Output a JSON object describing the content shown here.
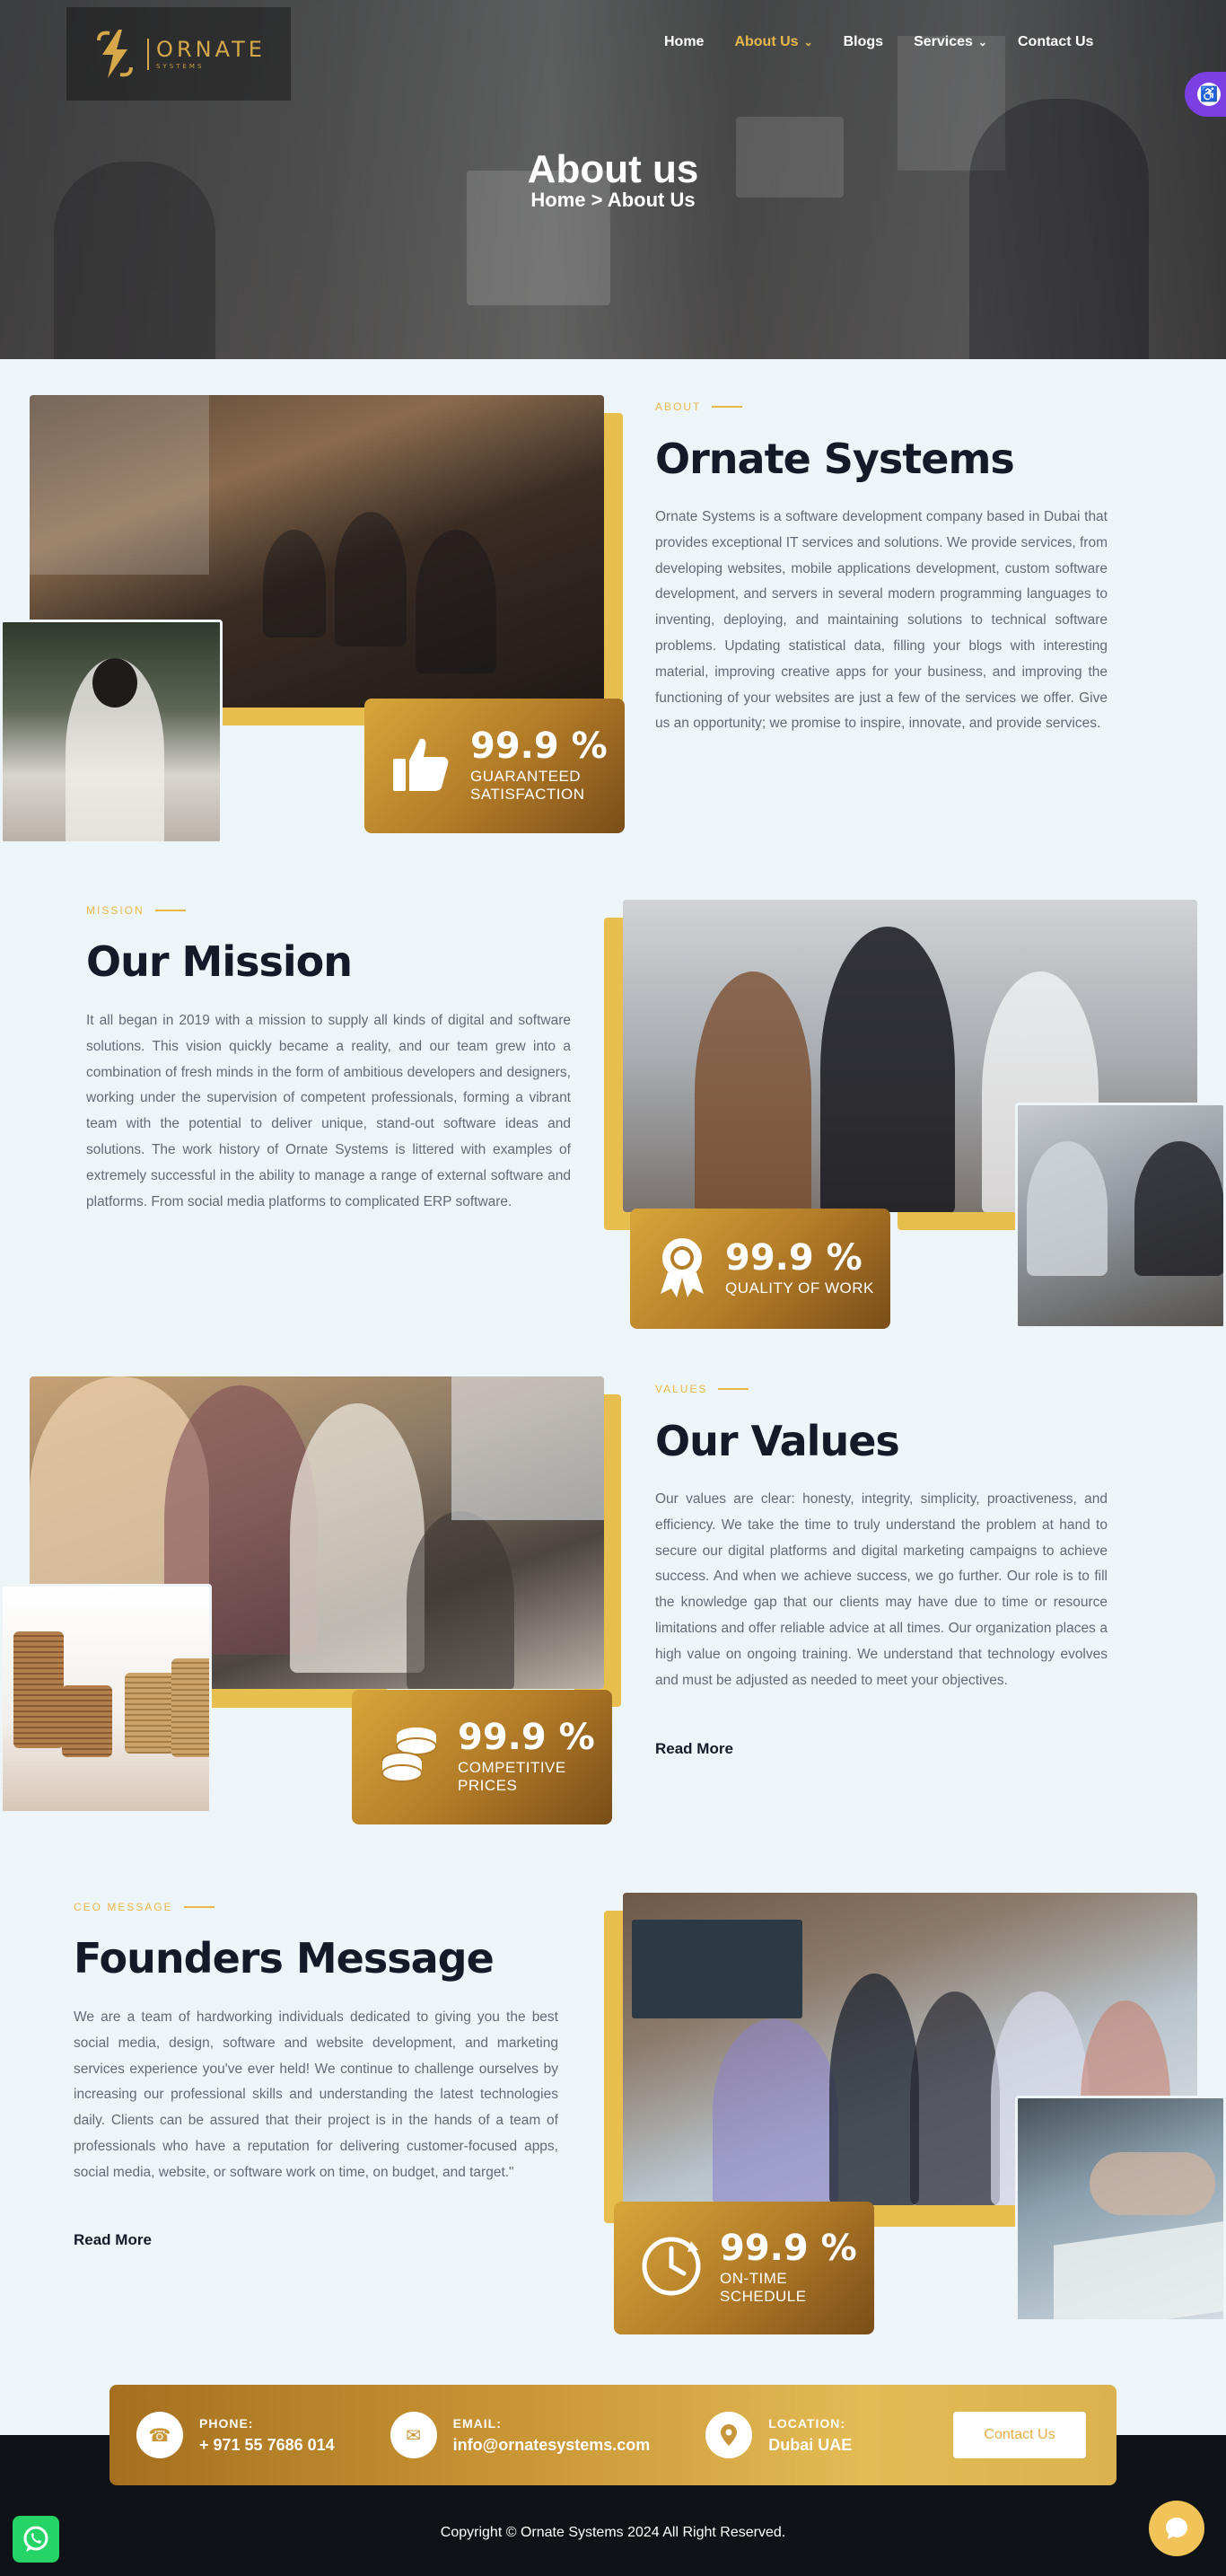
{
  "brand": {
    "name": "ORNATE",
    "tagline": "SYSTEMS"
  },
  "nav": {
    "items": [
      {
        "label": "Home"
      },
      {
        "label": "About Us"
      },
      {
        "label": "Blogs"
      },
      {
        "label": "Services"
      },
      {
        "label": "Contact Us"
      }
    ]
  },
  "hero": {
    "title": "About us",
    "breadcrumb": "Home > About Us"
  },
  "about": {
    "tag": "ABOUT",
    "title": "Ornate Systems",
    "body": "Ornate Systems is a software development company based in Dubai that provides exceptional IT services and solutions. We provide services, from developing websites, mobile applications development, custom software development, and servers in several modern programming languages to inventing, deploying, and maintaining solutions to technical software problems. Updating statistical data, filling your blogs with interesting material, improving creative apps for your business, and improving the functioning of your websites are just a few of the services we offer. Give us an opportunity; we promise to inspire, innovate, and provide services.",
    "stat": {
      "value": "99.9 %",
      "label": "GUARANTEED\nSATISFACTION",
      "icon": "thumbs-up-icon"
    }
  },
  "mission": {
    "tag": "MISSION",
    "title": "Our Mission",
    "body": "It all began in 2019 with a mission to supply all kinds of digital and software solutions. This vision quickly became a reality, and our team grew into a combination of fresh minds in the form of ambitious developers and designers, working under the supervision of competent professionals, forming a vibrant team with the potential to deliver unique, stand-out software ideas and solutions. The work history of Ornate Systems is littered with examples of extremely successful in the ability to manage a range of external software and platforms. From social media platforms to complicated ERP software.",
    "stat": {
      "value": "99.9 %",
      "label": "QUALITY OF WORK",
      "icon": "award-ribbon-icon"
    }
  },
  "values": {
    "tag": "VALUES",
    "title": "Our Values",
    "body": "Our values are clear: honesty, integrity, simplicity, proactiveness, and efficiency. We take the time to truly understand the problem at hand to secure our digital platforms and digital marketing campaigns to achieve success. And when we achieve success, we go further. Our role is to fill the knowledge gap that our clients may have due to time or resource limitations and offer reliable advice at all times. Our organization places a high value on ongoing training. We understand that technology evolves and must be adjusted as needed to meet your objectives.",
    "read_more": "Read More",
    "stat": {
      "value": "99.9 %",
      "label": "COMPETITIVE\nPRICES",
      "icon": "coins-icon"
    }
  },
  "founders": {
    "tag": "CEO MESSAGE",
    "title": "Founders Message",
    "body": "We are a team of hardworking individuals dedicated to giving you the best social media, design, software and website development, and marketing services experience you've ever held! We continue to challenge ourselves by increasing our professional skills and understanding the latest technologies daily. Clients can be assured that their project is in the hands of a team of professionals who have a reputation for delivering customer-focused apps, social media, website, or software work on time, on budget, and target.\"",
    "read_more": "Read More",
    "stat": {
      "value": "99.9 %",
      "label": "ON-TIME\nSCHEDULE",
      "icon": "clock-icon"
    }
  },
  "contact": {
    "phone": {
      "label": "PHONE:",
      "value": "+ 971 55 7686 014"
    },
    "email": {
      "label": "EMAIL:",
      "value": "info@ornatesystems.com"
    },
    "location": {
      "label": "LOCATION:",
      "value": "Dubai UAE"
    },
    "button": "Contact Us"
  },
  "footer": {
    "copyright": "Copyright © Ornate Systems 2024 All Right Reserved."
  },
  "colors": {
    "accent": "#e8bf4f",
    "accent_dark": "#7a4d18",
    "heading": "#141b28",
    "body": "#636a76",
    "bg": "#eef5f9"
  }
}
